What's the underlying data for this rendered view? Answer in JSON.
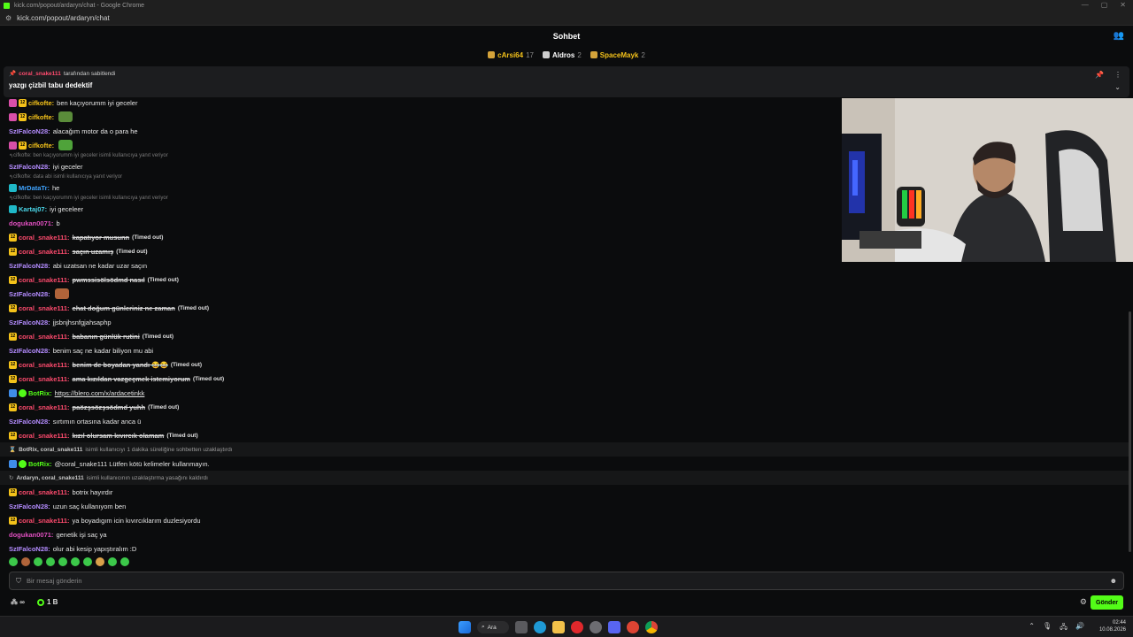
{
  "window": {
    "title": "kick.com/popout/ardaryn/chat - Google Chrome",
    "url": "kick.com/popout/ardaryn/chat"
  },
  "header": {
    "title": "Sohbet"
  },
  "leaderboard": [
    {
      "name": "cArsi64",
      "count": "17",
      "color": "#f4c21a"
    },
    {
      "name": "Aldros",
      "count": "2",
      "color": "#ffffff"
    },
    {
      "name": "SpaceMayk",
      "count": "2",
      "color": "#f4c21a"
    }
  ],
  "pinned": {
    "user": "coral_snake111",
    "suffix": "tarafından sabitlendi",
    "message": "yazgı çizbil tabu dedektif"
  },
  "messages": [
    {
      "user": "cifkofte",
      "color": "#f4c21a",
      "text": "ben kaçıyorumm iyi geceler",
      "badges": [
        "pink",
        "sub"
      ]
    },
    {
      "user": "cifkofte",
      "color": "#f4c21a",
      "emote": "#5a8c3a",
      "badges": [
        "pink",
        "sub"
      ]
    },
    {
      "user": "SzIFalcoN28",
      "color": "#b48cff",
      "text": "alacağım motor da o para he"
    },
    {
      "user": "cifkofte",
      "color": "#f4c21a",
      "emote": "#4fa33a",
      "badges": [
        "pink",
        "sub"
      ]
    },
    {
      "reply": "cifkofte: ben kaçıyorumm iyi geceler isimli kullanıcıya yanıt veriyor"
    },
    {
      "user": "SzIFalcoN28",
      "color": "#b48cff",
      "text": "iyi geceler"
    },
    {
      "reply": "cifkofte: data abi isimli kullanıcıya yanıt veriyor"
    },
    {
      "user": "MrDataTr",
      "color": "#3fa4ff",
      "text": "he",
      "badges": [
        "mod"
      ]
    },
    {
      "reply": "cifkofte: ben kaçıyorumm iyi geceler isimli kullanıcıya yanıt veriyor"
    },
    {
      "user": "Kartaj07",
      "color": "#4ad6e8",
      "text": "iyi geceleer",
      "badges": [
        "mod"
      ]
    },
    {
      "user": "dogukan0071",
      "color": "#e04fc0",
      "text": "b"
    },
    {
      "user": "coral_snake111",
      "color": "#ff4b6e",
      "text": "kapatıyor musunn",
      "struck": true,
      "badges": [
        "sub"
      ]
    },
    {
      "user": "coral_snake111",
      "color": "#ff4b6e",
      "text": "saçın uzamış",
      "struck": true,
      "badges": [
        "sub"
      ]
    },
    {
      "user": "SzIFalcoN28",
      "color": "#b48cff",
      "text": "abi uzatsan ne kadar uzar saçın"
    },
    {
      "user": "coral_snake111",
      "color": "#ff4b6e",
      "text": "pwmssisölsödmd nasıl",
      "struck": true,
      "badges": [
        "sub"
      ]
    },
    {
      "user": "SzIFalcoN28",
      "color": "#b48cff",
      "emote": "#b0643a"
    },
    {
      "user": "coral_snake111",
      "color": "#ff4b6e",
      "text": "chat doğum günleriniz ne zaman",
      "struck": true,
      "badges": [
        "sub"
      ]
    },
    {
      "user": "SzIFalcoN28",
      "color": "#b48cff",
      "text": "jjsbnjhsnfgjahsaphp"
    },
    {
      "user": "coral_snake111",
      "color": "#ff4b6e",
      "text": "babanın günlük rutini",
      "struck": true,
      "badges": [
        "sub"
      ]
    },
    {
      "user": "SzIFalcoN28",
      "color": "#b48cff",
      "text": "benim saç ne kadar biliyon mu abi"
    },
    {
      "user": "coral_snake111",
      "color": "#ff4b6e",
      "text": "benim de boyadan yandı 😂😂",
      "struck": true,
      "badges": [
        "sub"
      ]
    },
    {
      "user": "coral_snake111",
      "color": "#ff4b6e",
      "text": "ama kızıldan vazgeçmek istemiyorum",
      "struck": true,
      "badges": [
        "sub"
      ]
    },
    {
      "user": "BotRix",
      "color": "#53fc18",
      "text": "https://blero.com/x/ardacetinkk",
      "link": true,
      "badges": [
        "bot",
        "ver"
      ]
    },
    {
      "user": "coral_snake111",
      "color": "#ff4b6e",
      "text": "paözşsözşsödmd yuhh",
      "struck": true,
      "badges": [
        "sub"
      ]
    },
    {
      "user": "SzIFalcoN28",
      "color": "#b48cff",
      "text": "sırtımın ortasına kadar anca ü"
    },
    {
      "user": "coral_snake111",
      "color": "#ff4b6e",
      "text": "kızıl olursam kıvırcık olamam",
      "struck": true,
      "badges": [
        "sub"
      ]
    },
    {
      "system": true,
      "icon": "⌛",
      "users": "BotRix, coral_snake111",
      "text": "isimli kullanıcıyı 1 dakika süreliğine sohbetten uzaklaştırdı"
    },
    {
      "user": "BotRix",
      "color": "#53fc18",
      "text": "@coral_snake111 Lütfen kötü kelimeler kullanmayın.",
      "badges": [
        "bot",
        "ver"
      ]
    },
    {
      "system": true,
      "icon": "↻",
      "users": "Ardaryn, coral_snake111",
      "text": "isimli kullanıcının uzaklaştırma yasağını kaldırdı"
    },
    {
      "user": "coral_snake111",
      "color": "#ff4b6e",
      "text": "botrix hayırdır",
      "badges": [
        "sub"
      ]
    },
    {
      "user": "SzIFalcoN28",
      "color": "#b48cff",
      "text": "uzun saç kullanıyom ben"
    },
    {
      "user": "coral_snake111",
      "color": "#ff4b6e",
      "text": "ya boyadıgım icin kıvırcıklarım duzlesiyordu",
      "badges": [
        "sub"
      ]
    },
    {
      "user": "dogukan0071",
      "color": "#e04fc0",
      "text": "genetik işi saç ya"
    },
    {
      "user": "SzIFalcoN28",
      "color": "#b48cff",
      "text": "olur abi kesip yapıştıralım :D"
    }
  ],
  "timed_out_label": "(Timed out)",
  "input": {
    "placeholder": "Bir mesaj gönderin"
  },
  "footer": {
    "points_a": "∞",
    "points_b": "1 B",
    "send_label": "Gönder"
  },
  "taskbar": {
    "search_label": "Ara",
    "time": "02:44",
    "date": "10.08.2026"
  },
  "colors": {
    "accent": "#53fc18",
    "bg": "#0b0c0d"
  }
}
